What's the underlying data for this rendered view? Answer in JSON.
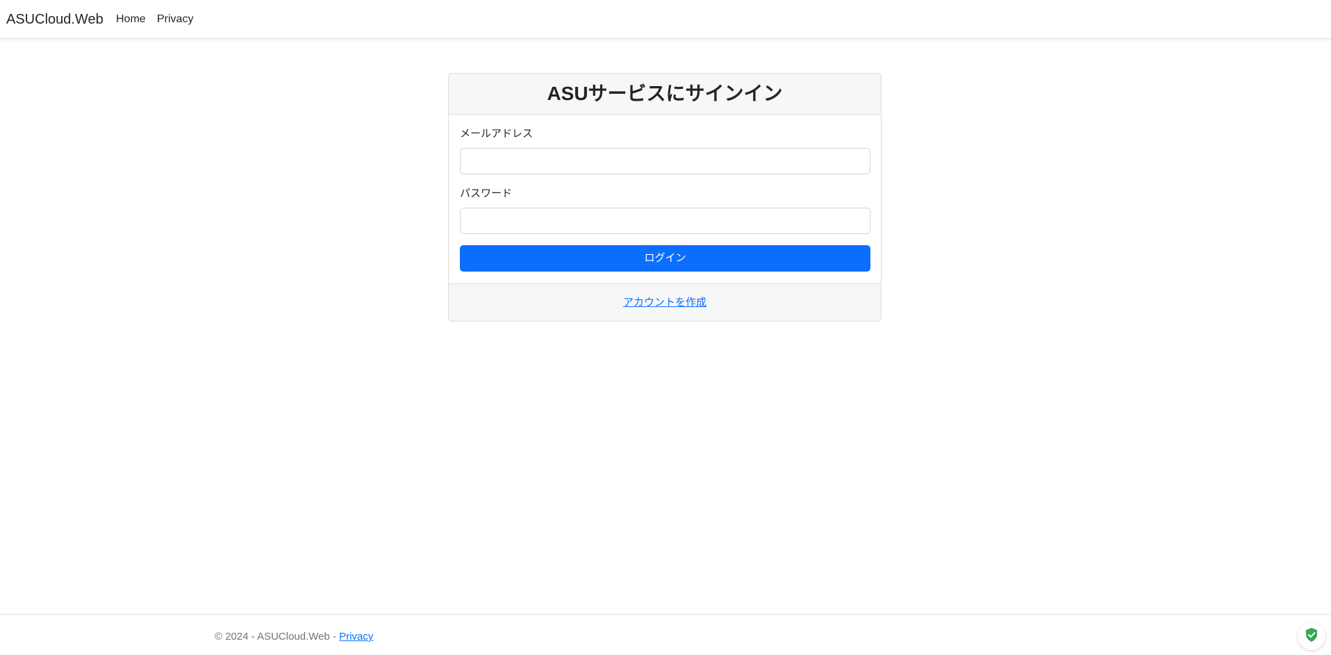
{
  "navbar": {
    "brand": "ASUCloud.Web",
    "links": [
      {
        "label": "Home"
      },
      {
        "label": "Privacy"
      }
    ]
  },
  "login_card": {
    "title": "ASUサービスにサインイン",
    "email_label": "メールアドレス",
    "email_value": "",
    "password_label": "パスワード",
    "password_value": "",
    "login_button": "ログイン",
    "create_account_link": "アカウントを作成"
  },
  "footer": {
    "copyright": "© 2024 - ASUCloud.Web - ",
    "privacy_link": "Privacy"
  },
  "colors": {
    "primary": "#0d6efd",
    "card_header_bg": "#f7f7f7",
    "footer_text": "#6c757d",
    "shield": "#3aa55b"
  },
  "icons": {
    "security_badge": "shield-check-icon"
  }
}
